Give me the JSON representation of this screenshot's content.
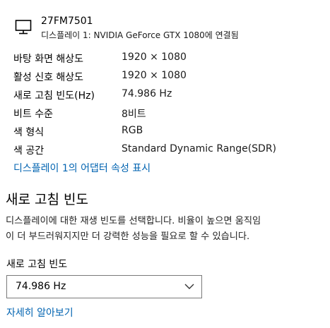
{
  "monitor": {
    "icon": "monitor-icon",
    "name": "27FM7501",
    "subtitle": "디스플레이 1: NVIDIA GeForce GTX 1080에 연결됨"
  },
  "info": [
    {
      "label": "바탕 화면 해상도",
      "value": "1920 × 1080"
    },
    {
      "label": "활성 신호 해상도",
      "value": "1920 × 1080"
    },
    {
      "label": "새로 고침 빈도(Hz)",
      "value": "74.986 Hz"
    },
    {
      "label": "비트 수준",
      "value": "8비트"
    },
    {
      "label": "색 형식",
      "value": "RGB"
    },
    {
      "label": "색 공간",
      "value": "Standard Dynamic Range(SDR)"
    }
  ],
  "adapter_link": "디스플레이 1의 어댑터 속성 표시",
  "refresh_section": {
    "title": "새로 고침 빈도",
    "description_lines": [
      "디스플레이에 대한 재생 빈도를 선택합니다. 비율이 높으면 움직임",
      "이 더 부드러워지지만 더 강력한 성능을 필요로 할 수 있습니다."
    ],
    "dropdown_label": "새로 고침 빈도",
    "dropdown_value": "74.986 Hz",
    "dropdown_icon": "chevron-down-icon",
    "learn_more": "자세히 알아보기"
  },
  "colors": {
    "link": "#0063b1",
    "text": "#000000",
    "border": "#7a7a7a"
  }
}
